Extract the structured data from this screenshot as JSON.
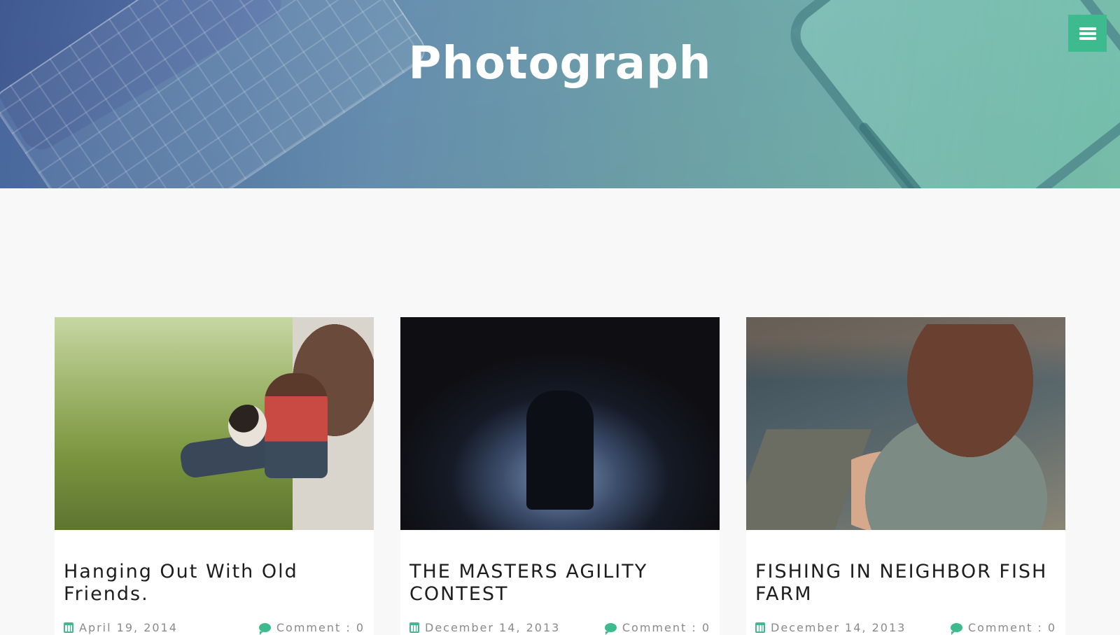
{
  "header": {
    "site_title": "Photograph",
    "menu_icon": "hamburger-menu-icon",
    "accent_color": "#3dbb8f"
  },
  "posts": [
    {
      "title": "Hanging Out With Old Friends.",
      "date": "April 19, 2014",
      "comments_label": "Comment : 0",
      "image": "man-and-dog-in-grass-photo"
    },
    {
      "title": "THE MASTERS AGILITY CONTEST",
      "date": "December 14, 2013",
      "comments_label": "Comment : 0",
      "image": "couple-kissing-at-night-photo"
    },
    {
      "title": "FISHING IN NEIGHBOR FISH FARM",
      "date": "December 14, 2013",
      "comments_label": "Comment : 0",
      "image": "girl-sitting-by-water-photo"
    }
  ]
}
